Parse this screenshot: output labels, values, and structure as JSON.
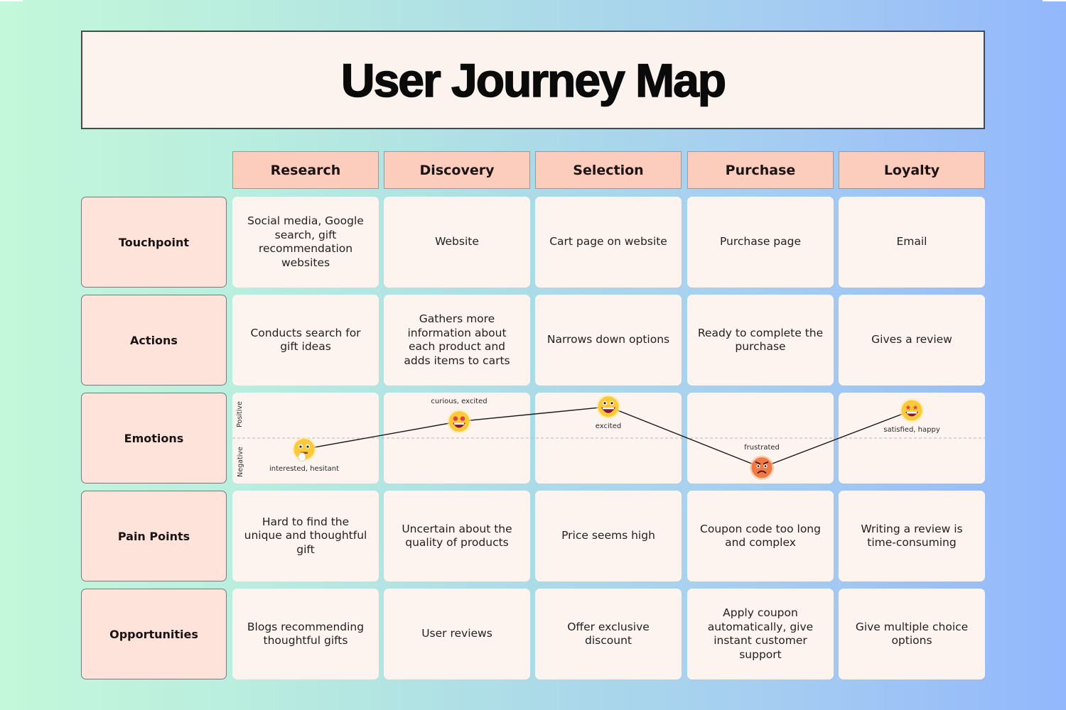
{
  "title": "User Journey Map",
  "stages": [
    "Research",
    "Discovery",
    "Selection",
    "Purchase",
    "Loyalty"
  ],
  "rows": [
    {
      "label": "Touchpoint",
      "cells": [
        "Social media, Google search, gift recommendation websites",
        "Website",
        "Cart page on website",
        "Purchase page",
        "Email"
      ]
    },
    {
      "label": "Actions",
      "cells": [
        "Conducts search for gift ideas",
        "Gathers more information about each product and adds items to carts",
        "Narrows down options",
        "Ready to complete the purchase",
        "Gives a review"
      ]
    },
    {
      "label": "Emotions",
      "cells": []
    },
    {
      "label": "Pain Points",
      "cells": [
        "Hard to find the unique and thoughtful gift",
        "Uncertain about the quality of products",
        "Price seems high",
        "Coupon code too long and complex",
        "Writing a review is time-consuming"
      ]
    },
    {
      "label": "Opportunities",
      "cells": [
        "Blogs recommending thoughtful gifts",
        "User reviews",
        "Offer exclusive discount",
        "Apply coupon automatically, give instant customer support",
        "Give multiple choice options"
      ]
    }
  ],
  "emotions": {
    "axis_positive": "Positive",
    "axis_negative": "Negative",
    "points": [
      {
        "stage": "Research",
        "label": "interested, hesitant",
        "emoji": "thinking-face-icon",
        "sentiment": -0.3,
        "label_position": "below"
      },
      {
        "stage": "Discovery",
        "label": "curious, excited",
        "emoji": "heart-eyes-face-icon",
        "sentiment": 0.45,
        "label_position": "above"
      },
      {
        "stage": "Selection",
        "label": "excited",
        "emoji": "grinning-face-icon",
        "sentiment": 0.85,
        "label_position": "below"
      },
      {
        "stage": "Purchase",
        "label": "frustrated",
        "emoji": "angry-face-icon",
        "sentiment": -0.8,
        "label_position": "above"
      },
      {
        "stage": "Loyalty",
        "label": "satisfied, happy",
        "emoji": "star-eyes-face-icon",
        "sentiment": 0.75,
        "label_position": "below"
      }
    ]
  },
  "colors": {
    "stage_header_bg": "#fccdbd",
    "row_label_bg": "#fde3da",
    "cell_bg": "#fdf4ef",
    "gradient_left": "#c4f8da",
    "gradient_right": "#93b7fc"
  }
}
